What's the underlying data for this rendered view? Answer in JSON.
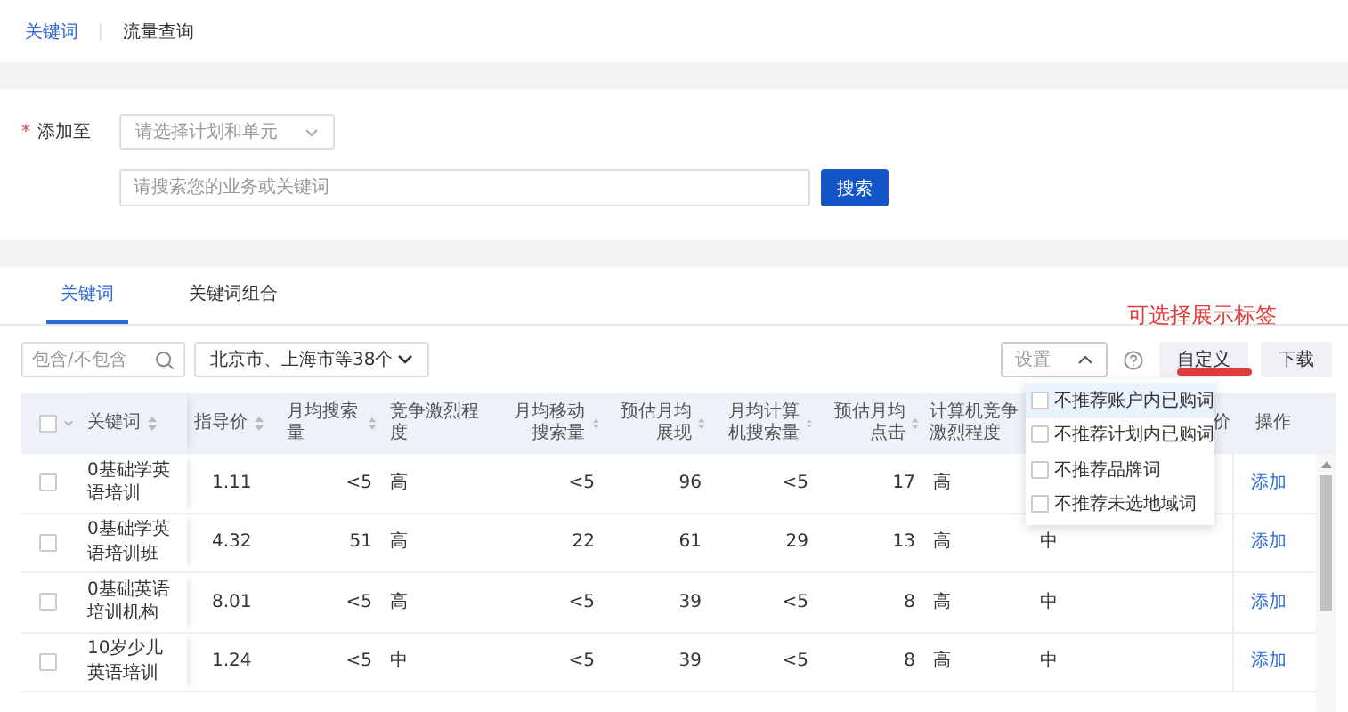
{
  "top_tabs": [
    {
      "label": "关键词",
      "selected": true
    },
    {
      "label": "流量查询",
      "selected": false
    }
  ],
  "form": {
    "label": "添加至",
    "required_mark": "*",
    "unit_select": {
      "placeholder": "请选择计划和单元"
    },
    "search_field": {
      "placeholder": "请搜索您的业务或关键词"
    },
    "search_button": "搜索"
  },
  "card_tabs": [
    {
      "label": "关键词",
      "selected": true
    },
    {
      "label": "关键词组合",
      "selected": false
    }
  ],
  "filters": {
    "include_field": {
      "placeholder": "包含/不包含"
    },
    "region_select": {
      "value": "北京市、上海市等38个"
    }
  },
  "toolbar": {
    "settings_select": {
      "placeholder": "设置",
      "expanded": true
    },
    "customize_button": "自定义",
    "download_button": "下载"
  },
  "settings_menu": [
    {
      "label": "不推荐账户内已购词",
      "checked": false,
      "highlighted": true
    },
    {
      "label": "不推荐计划内已购词",
      "checked": false,
      "highlighted": false
    },
    {
      "label": "不推荐品牌词",
      "checked": false,
      "highlighted": false
    },
    {
      "label": "不推荐未选地域词",
      "checked": false,
      "highlighted": false
    }
  ],
  "annotation": "可选择展示标签",
  "table": {
    "select_all_checked": false,
    "columns": [
      {
        "label": "关键词",
        "sortable": true
      },
      {
        "label": "指导价",
        "sortable": true
      },
      {
        "label": "月均搜索量",
        "sortable": true
      },
      {
        "label": "竞争激烈程度",
        "sortable": false
      },
      {
        "label": "月均移动搜索量",
        "sortable": true
      },
      {
        "label": "预估月均展现",
        "sortable": true
      },
      {
        "label": "月均计算机搜索量",
        "sortable": true
      },
      {
        "label": "预估月均点击",
        "sortable": true
      },
      {
        "label": "计算机竞争激烈程度",
        "sortable": false
      },
      {
        "label": "价",
        "sortable": false
      },
      {
        "label": "操作",
        "sortable": false
      }
    ],
    "rows": [
      {
        "checked": false,
        "cells": [
          "0基础学英语培训",
          "1.11",
          "<5",
          "高",
          "<5",
          "96",
          "<5",
          "17",
          "高",
          null
        ],
        "action": "添加"
      },
      {
        "checked": false,
        "cells": [
          "0基础学英语培训班",
          "4.32",
          "51",
          "高",
          "22",
          "61",
          "29",
          "13",
          "高",
          "中"
        ],
        "action": "添加"
      },
      {
        "checked": false,
        "cells": [
          "0基础英语培训机构",
          "8.01",
          "<5",
          "高",
          "<5",
          "39",
          "<5",
          "8",
          "高",
          "中"
        ],
        "action": "添加"
      },
      {
        "checked": false,
        "cells": [
          "10岁少儿英语培训",
          "1.24",
          "<5",
          "中",
          "<5",
          "39",
          "<5",
          "8",
          "高",
          "中"
        ],
        "action": "添加"
      }
    ]
  }
}
